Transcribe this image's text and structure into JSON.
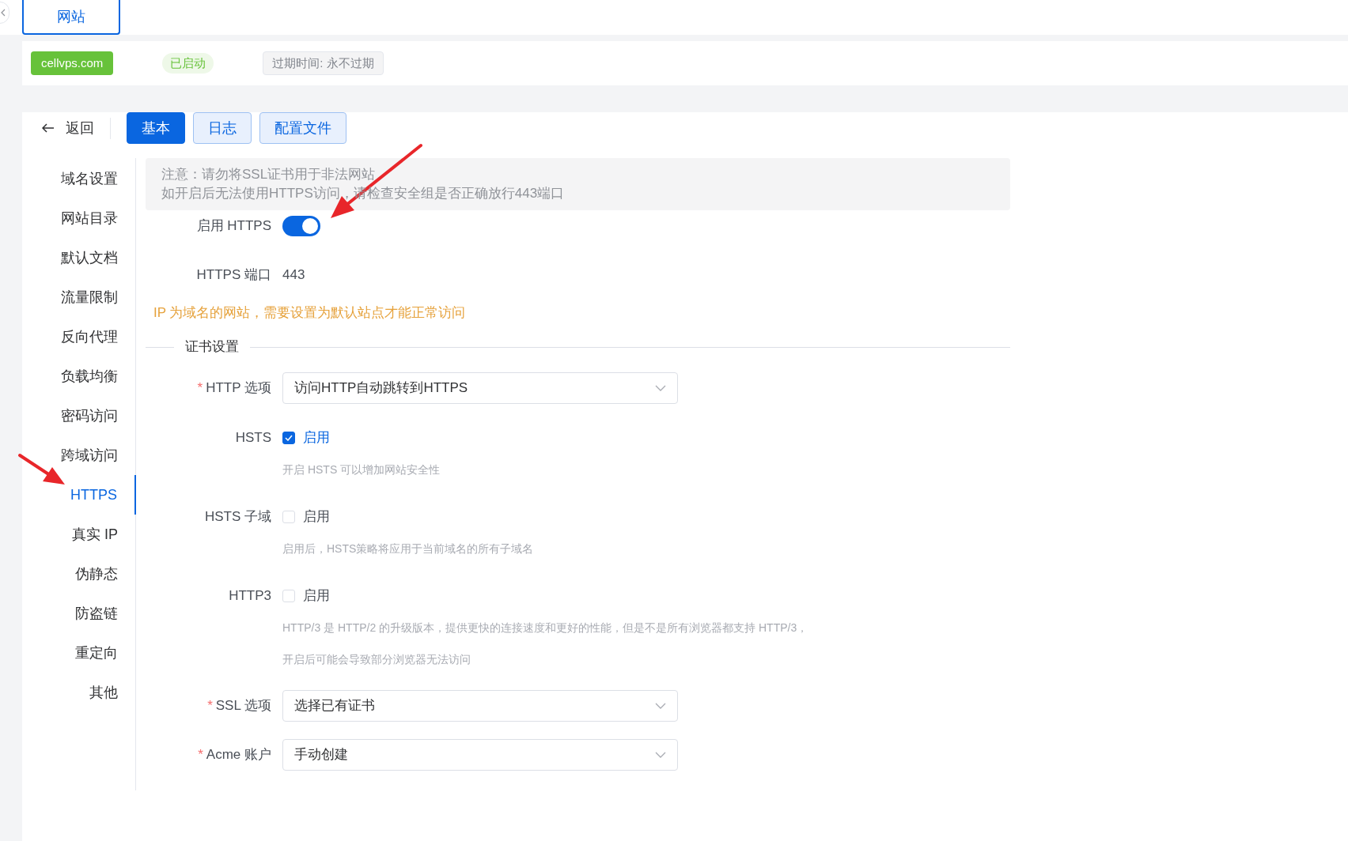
{
  "top_tab": {
    "label": "网站",
    "selected": true
  },
  "site": {
    "domain": "cellvps.com",
    "status": "已启动",
    "expiry": "过期时间: 永不过期"
  },
  "back": "返回",
  "tabs": [
    {
      "label": "基本",
      "selected": true
    },
    {
      "label": "日志",
      "selected": false
    },
    {
      "label": "配置文件",
      "selected": false
    }
  ],
  "sidebar": [
    {
      "label": "域名设置",
      "selected": false
    },
    {
      "label": "网站目录",
      "selected": false
    },
    {
      "label": "默认文档",
      "selected": false
    },
    {
      "label": "流量限制",
      "selected": false
    },
    {
      "label": "反向代理",
      "selected": false
    },
    {
      "label": "负载均衡",
      "selected": false
    },
    {
      "label": "密码访问",
      "selected": false
    },
    {
      "label": "跨域访问",
      "selected": false
    },
    {
      "label": "HTTPS",
      "selected": true
    },
    {
      "label": "真实 IP",
      "selected": false
    },
    {
      "label": "伪静态",
      "selected": false
    },
    {
      "label": "防盗链",
      "selected": false
    },
    {
      "label": "重定向",
      "selected": false
    },
    {
      "label": "其他",
      "selected": false
    }
  ],
  "notice": [
    "注意：请勿将SSL证书用于非法网站",
    "如开启后无法使用HTTPS访问，请检查安全组是否正确放行443端口"
  ],
  "enable_https": {
    "label": "启用 HTTPS",
    "on": true
  },
  "https_port": {
    "label": "HTTPS 端口",
    "value": "443"
  },
  "warning": "IP 为域名的网站，需要设置为默认站点才能正常访问",
  "section": "证书设置",
  "fields": [
    {
      "kind": "select",
      "label": "HTTP 选项",
      "required_mark": "*",
      "value": "访问HTTP自动跳转到HTTPS"
    },
    {
      "kind": "checkbox",
      "label": "HSTS",
      "option": "启用",
      "checked": true,
      "help": [
        "开启 HSTS 可以增加网站安全性"
      ]
    },
    {
      "kind": "checkbox",
      "label": "HSTS 子域",
      "option": "启用",
      "checked": false,
      "help": [
        "启用后，HSTS策略将应用于当前域名的所有子域名"
      ]
    },
    {
      "kind": "checkbox",
      "label": "HTTP3",
      "option": "启用",
      "checked": false,
      "help": [
        "HTTP/3 是 HTTP/2 的升级版本，提供更快的连接速度和更好的性能，但是不是所有浏览器都支持 HTTP/3，",
        "开启后可能会导致部分浏览器无法访问"
      ]
    },
    {
      "kind": "select",
      "label": "SSL 选项",
      "required_mark": "*",
      "value": "选择已有证书"
    },
    {
      "kind": "select",
      "label": "Acme 账户",
      "required_mark": "*",
      "value": "手动创建"
    }
  ]
}
